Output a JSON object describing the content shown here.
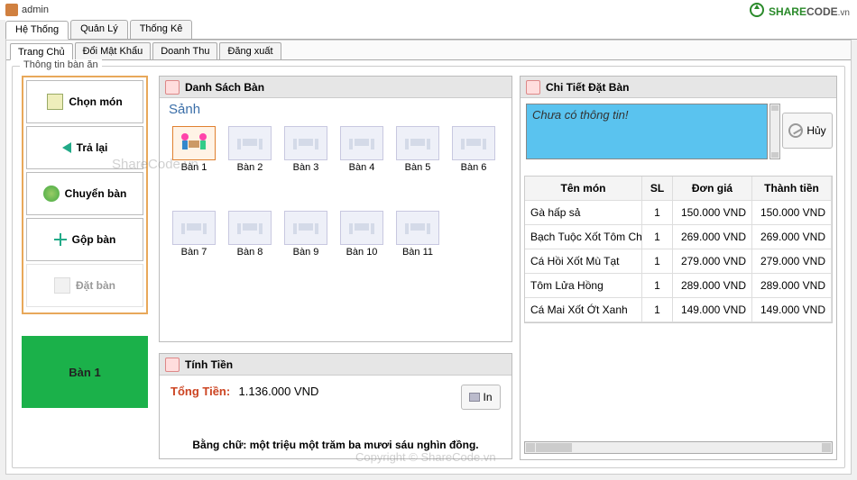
{
  "window": {
    "title": "admin"
  },
  "brand": {
    "text1": "SHARE",
    "text2": "CODE",
    "suffix": ".vn"
  },
  "top_tabs": [
    {
      "label": "Hệ Thống",
      "active": true
    },
    {
      "label": "Quản Lý"
    },
    {
      "label": "Thống Kê"
    }
  ],
  "sub_tabs": [
    {
      "label": "Trang Chủ",
      "active": true
    },
    {
      "label": "Đổi Mật Khẩu"
    },
    {
      "label": "Doanh Thu"
    },
    {
      "label": "Đăng xuất"
    }
  ],
  "groupbox_label": "Thông tin bàn ăn",
  "sidebar": {
    "items": [
      {
        "label": "Chọn món",
        "icon": "menu"
      },
      {
        "label": "Trả lại",
        "icon": "back"
      },
      {
        "label": "Chuyển bàn",
        "icon": "move"
      },
      {
        "label": "Gộp bàn",
        "icon": "merge"
      },
      {
        "label": "Đặt bàn",
        "icon": "book",
        "disabled": true
      }
    ]
  },
  "current_table": "Bàn 1",
  "tables_panel": {
    "title": "Danh Sách Bàn",
    "hall": "Sảnh",
    "tables": [
      {
        "name": "Bàn 1",
        "occupied": true,
        "selected": true
      },
      {
        "name": "Bàn 2"
      },
      {
        "name": "Bàn 3"
      },
      {
        "name": "Bàn 4"
      },
      {
        "name": "Bàn 5"
      },
      {
        "name": "Bàn 6"
      },
      {
        "name": "Bàn 7"
      },
      {
        "name": "Bàn 8"
      },
      {
        "name": "Bàn 9"
      },
      {
        "name": "Bàn 10"
      },
      {
        "name": "Bàn 11"
      }
    ]
  },
  "money_panel": {
    "title": "Tính Tiền",
    "total_label": "Tổng Tiền:",
    "total_value": "1.136.000 VND",
    "print_label": "In",
    "words": "Bằng chữ: một triệu một trăm ba mươi sáu nghìn đồng."
  },
  "detail_panel": {
    "title": "Chi Tiết Đặt Bàn",
    "message": "Chưa có thông tin!",
    "cancel_label": "Hủy",
    "columns": {
      "name": "Tên món",
      "qty": "SL",
      "price": "Đơn giá",
      "sum": "Thành tiền"
    },
    "rows": [
      {
        "name": "Gà hấp sả",
        "qty": "1",
        "price": "150.000 VND",
        "sum": "150.000 VND"
      },
      {
        "name": "Bạch Tuộc Xốt Tôm Chua",
        "qty": "1",
        "price": "269.000 VND",
        "sum": "269.000 VND"
      },
      {
        "name": "Cá Hồi Xốt Mù Tạt",
        "qty": "1",
        "price": "279.000 VND",
        "sum": "279.000 VND"
      },
      {
        "name": "Tôm Lửa Hồng",
        "qty": "1",
        "price": "289.000 VND",
        "sum": "289.000 VND"
      },
      {
        "name": "Cá Mai Xốt Ớt Xanh",
        "qty": "1",
        "price": "149.000 VND",
        "sum": "149.000 VND"
      }
    ]
  },
  "watermarks": {
    "w1": "ShareCode.vn",
    "w2": "Copyright © ShareCode.vn"
  }
}
